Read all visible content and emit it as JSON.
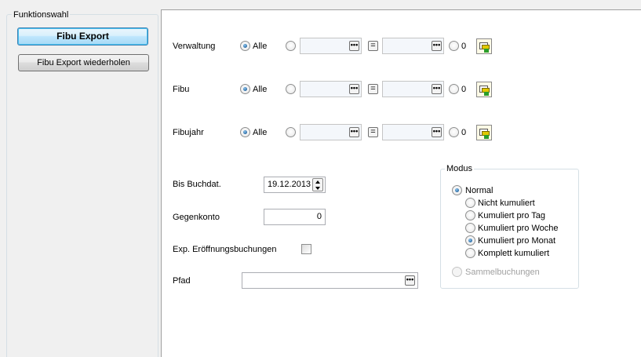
{
  "sidebar": {
    "group_title": "Funktionswahl",
    "buttons": [
      "Fibu Export",
      "Fibu Export wiederholen"
    ]
  },
  "filters": [
    {
      "label": "Verwaltung",
      "all_label": "Alle",
      "zero_label": "0",
      "from_value": "",
      "to_value": "",
      "selected": "Alle"
    },
    {
      "label": "Fibu",
      "all_label": "Alle",
      "zero_label": "0",
      "from_value": "",
      "to_value": "",
      "selected": "Alle"
    },
    {
      "label": "Fibujahr",
      "all_label": "Alle",
      "zero_label": "0",
      "from_value": "",
      "to_value": "",
      "selected": "Alle"
    }
  ],
  "ellipsis_glyph": "•••",
  "equals_glyph": "=",
  "form": {
    "bis_buchdat_label": "Bis Buchdat.",
    "bis_buchdat_value": "19.12.2013",
    "gegenkonto_label": "Gegenkonto",
    "gegenkonto_value": "0",
    "exp_eroeffnung_label": "Exp. Eröffnungsbuchungen",
    "exp_eroeffnung_checked": false,
    "pfad_label": "Pfad",
    "pfad_value": ""
  },
  "modus": {
    "title": "Modus",
    "normal_label": "Normal",
    "normal_checked": true,
    "options": [
      {
        "label": "Nicht kumuliert",
        "checked": false
      },
      {
        "label": "Kumuliert pro Tag",
        "checked": false
      },
      {
        "label": "Kumuliert pro Woche",
        "checked": false
      },
      {
        "label": "Kumuliert pro Monat",
        "checked": true
      },
      {
        "label": "Komplett kumuliert",
        "checked": false
      }
    ],
    "sammel_label": "Sammelbuchungen",
    "sammel_enabled": false
  },
  "colors": {
    "accent": "#3c7fb1",
    "panel_bg": "#f0f0f0",
    "content_bg": "#ffffff"
  }
}
